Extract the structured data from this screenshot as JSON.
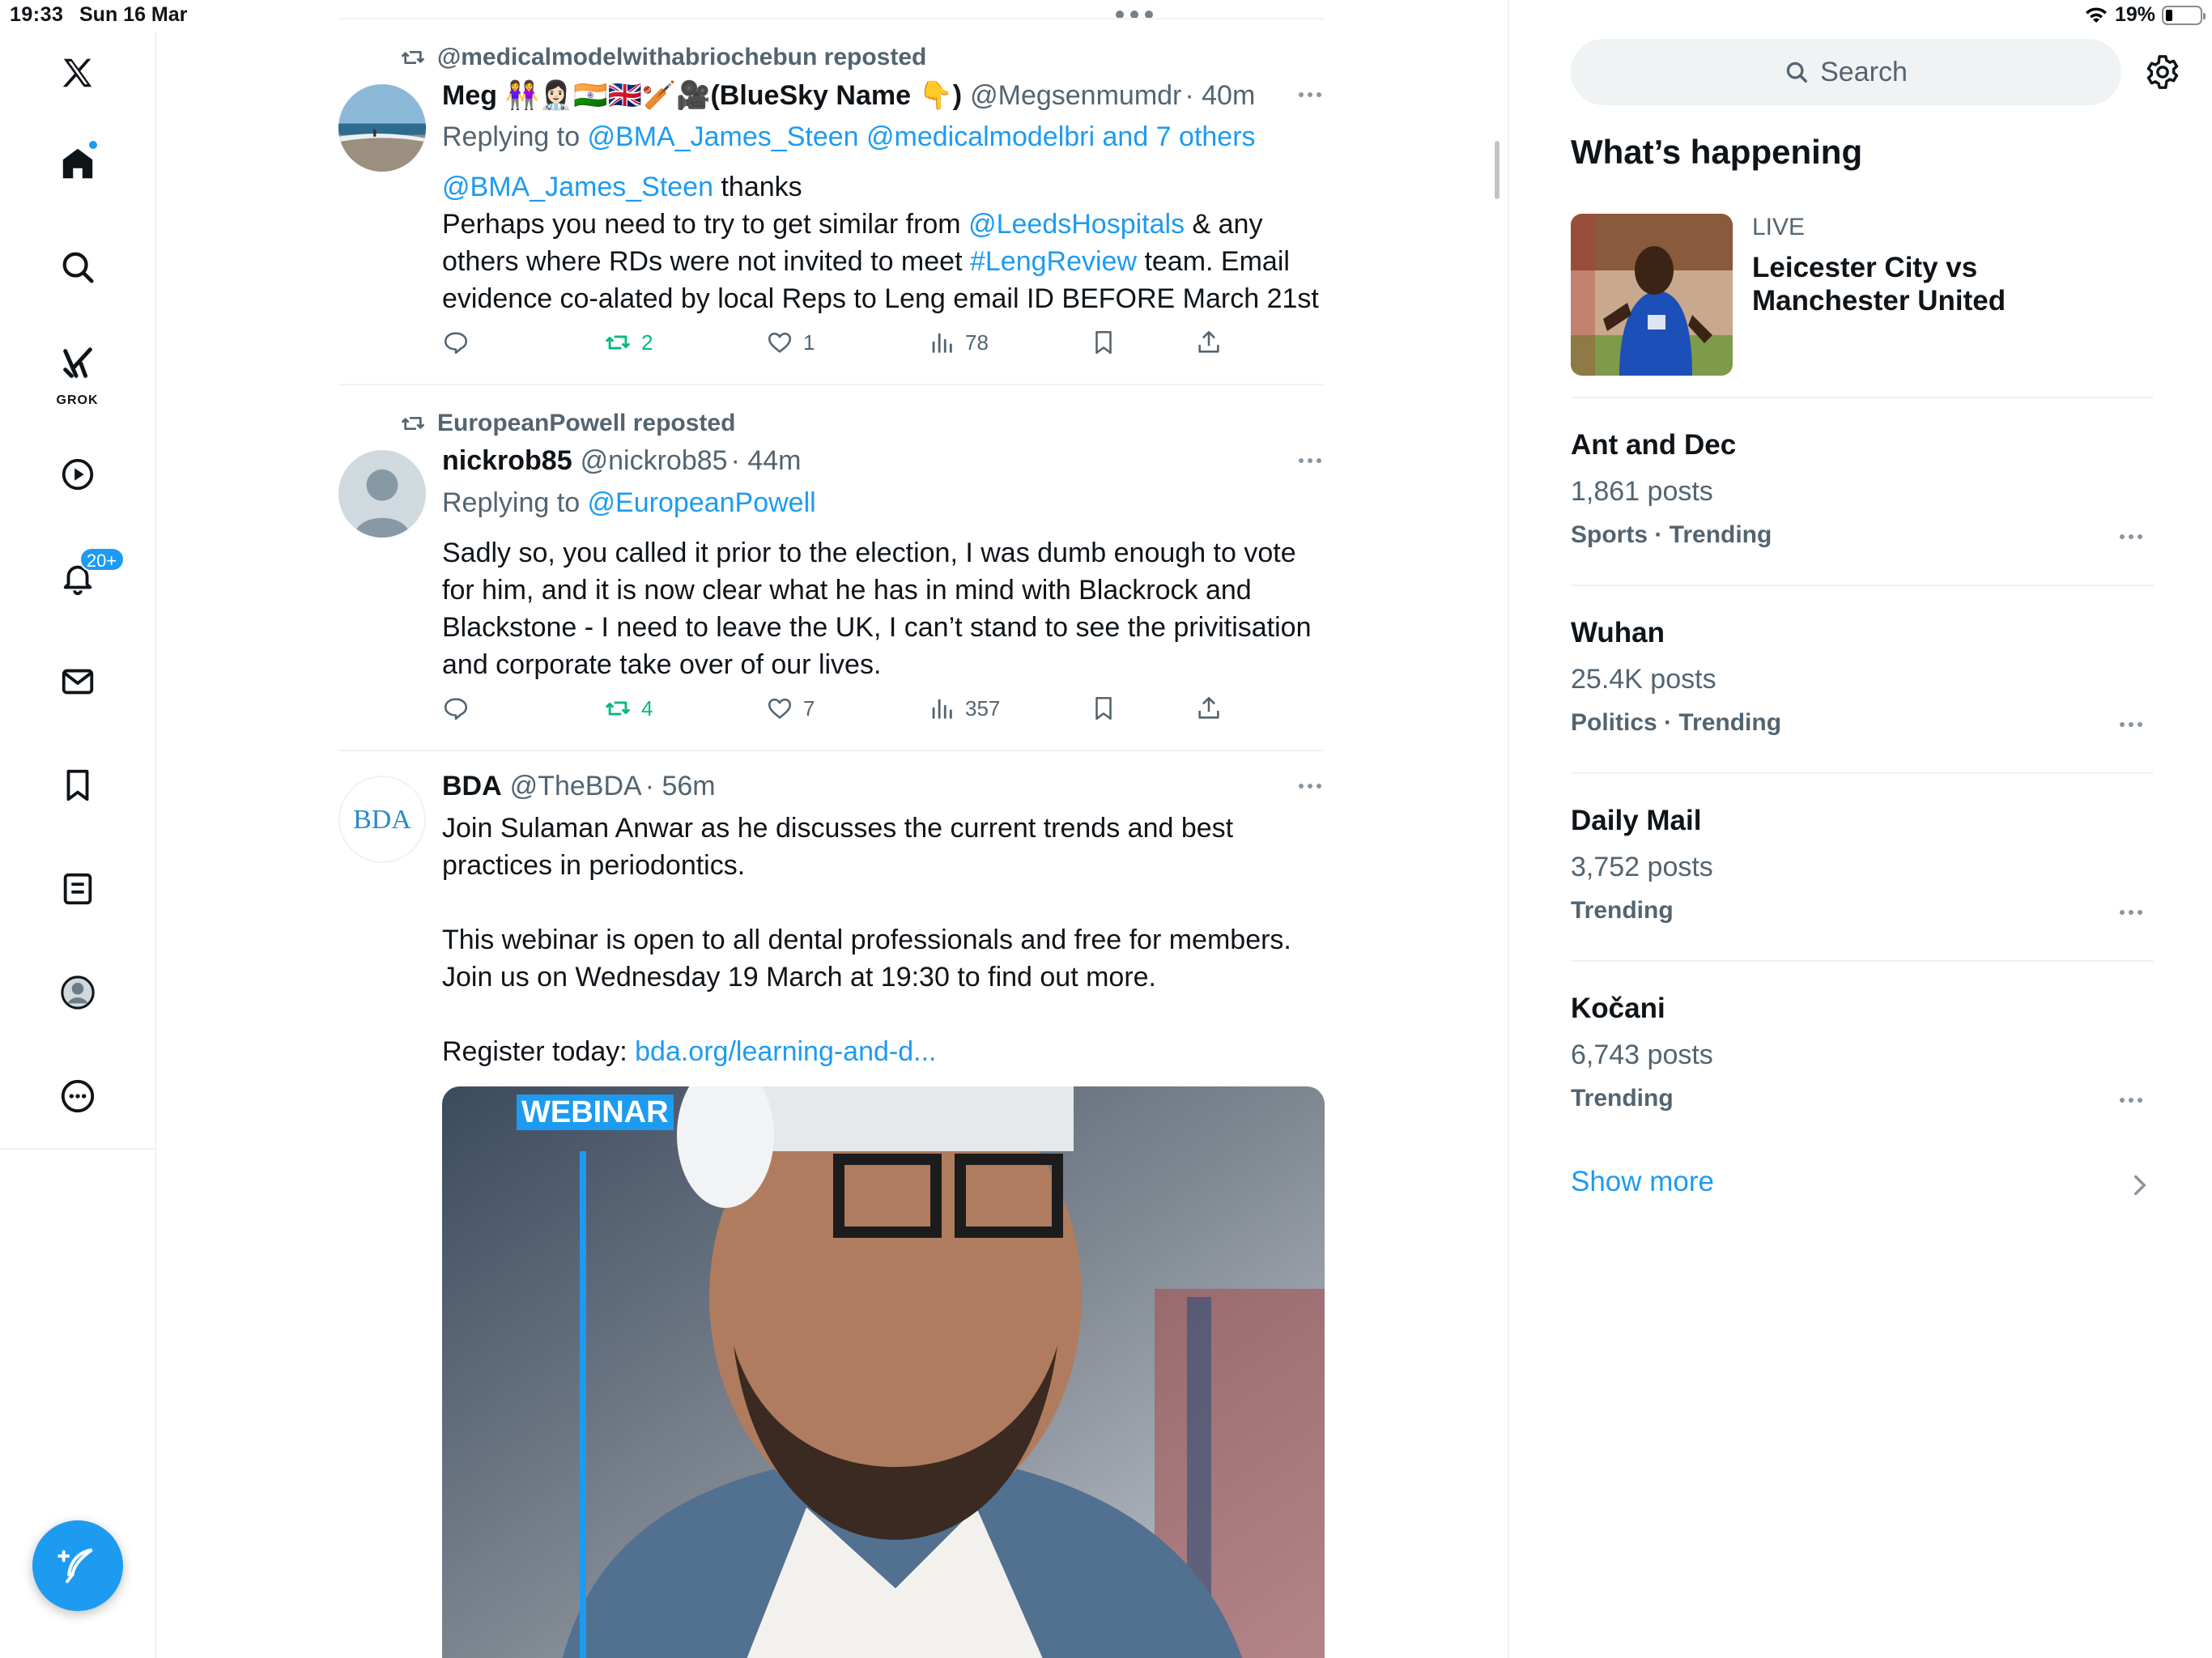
{
  "status_bar": {
    "time": "19:33",
    "date": "Sun 16 Mar",
    "battery": "19%"
  },
  "nav": {
    "items": [
      {
        "name": "x-logo",
        "label": ""
      },
      {
        "name": "home",
        "label": ""
      },
      {
        "name": "explore",
        "label": ""
      },
      {
        "name": "grok",
        "label": "GROK"
      },
      {
        "name": "videos",
        "label": ""
      },
      {
        "name": "notifications",
        "label": "",
        "badge": "20+"
      },
      {
        "name": "messages",
        "label": ""
      },
      {
        "name": "bookmarks",
        "label": ""
      },
      {
        "name": "lists",
        "label": ""
      },
      {
        "name": "profile",
        "label": ""
      },
      {
        "name": "more",
        "label": ""
      }
    ]
  },
  "feed": {
    "tweets": [
      {
        "repost_by": "@medicalmodelwithabriochebun reposted",
        "name": "Meg 👭👩🏻‍⚕️🇮🇳🇬🇧🏏🎥(BlueSky Name 👇)",
        "handle": "@Megsenmumdr",
        "time": "· 40m",
        "replying_prefix": "Replying to ",
        "replying_to": "@BMA_James_Steen @medicalmodelbri and 7 others",
        "body_parts": {
          "mention1": "@BMA_James_Steen",
          "text1": " thanks",
          "line2": "Perhaps you need to try to get similar from ",
          "mention2": "@LeedsHospitals",
          "text2": " & any others where RDs were not invited to meet ",
          "hashtag": "#LengReview",
          "text3": " team. Email evidence co-alated by local Reps to Leng email ID BEFORE March 21st"
        },
        "stats": {
          "replies": "",
          "reposts": "2",
          "likes": "1",
          "views": "78"
        }
      },
      {
        "repost_by": "EuropeanPowell reposted",
        "name": "nickrob85",
        "handle": "@nickrob85",
        "time": "· 44m",
        "replying_prefix": "Replying to ",
        "replying_to": "@EuropeanPowell",
        "body": "Sadly so, you called it prior to the election, I was dumb enough to vote for him, and it is now clear what he has in mind with Blackrock and Blackstone - I need to leave the UK, I can’t stand to see the privitisation and corporate take over of our lives.",
        "stats": {
          "replies": "",
          "reposts": "4",
          "likes": "7",
          "views": "357"
        }
      },
      {
        "name": "BDA",
        "handle": "@TheBDA",
        "time": "· 56m",
        "avatar_text": "BDA",
        "body_p1": "Join Sulaman Anwar as he discusses the current trends and best practices in periodontics.",
        "body_p2": "This webinar is open to all dental professionals and free for members. Join us on Wednesday 19 March at 19:30 to find out more.",
        "register_label": "Register today: ",
        "register_link": "bda.org/learning-and-d...",
        "media_badge": "WEBINAR"
      }
    ]
  },
  "sidebar": {
    "search_placeholder": "Search",
    "heading": "What’s happening",
    "live": {
      "label": "LIVE",
      "title": "Leicester City vs Manchester United"
    },
    "trends": [
      {
        "title": "Ant and Dec",
        "count": "1,861 posts",
        "meta": "Sports · Trending"
      },
      {
        "title": "Wuhan",
        "count": "25.4K posts",
        "meta": "Politics · Trending"
      },
      {
        "title": "Daily Mail",
        "count": "3,752 posts",
        "meta": "Trending"
      },
      {
        "title": "Kočani",
        "count": "6,743 posts",
        "meta": "Trending"
      }
    ],
    "show_more": "Show more"
  },
  "colors": {
    "accent": "#1d9bf0",
    "repost_green": "#00ba7c",
    "muted": "#536471"
  }
}
